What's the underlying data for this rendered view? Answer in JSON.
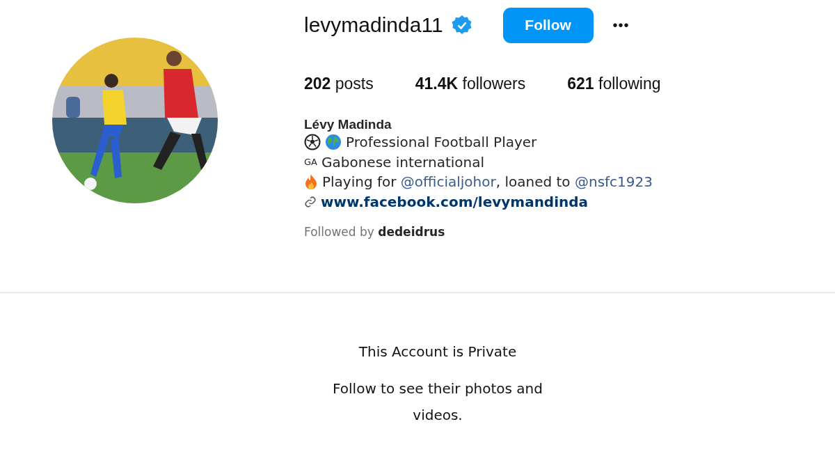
{
  "profile": {
    "username": "levymadinda11",
    "verified": true,
    "follow_button": "Follow",
    "more_button": "•••"
  },
  "stats": [
    {
      "count": "202",
      "label": "posts"
    },
    {
      "count": "41.4K",
      "label": "followers"
    },
    {
      "count": "621",
      "label": "following"
    }
  ],
  "full_name": "Lévy Madinda",
  "bio": [
    {
      "kind": "sport",
      "segments": [
        {
          "text": "Professional Football Player"
        }
      ]
    },
    {
      "kind": "country",
      "prefix": "GA",
      "segments": [
        {
          "text": "Gabonese international"
        }
      ]
    },
    {
      "kind": "club",
      "segments": [
        {
          "text": "Playing for "
        },
        {
          "text": "@officialjohor",
          "kind": "mention"
        },
        {
          "text": ", loaned to "
        },
        {
          "text": "@nsfc1923",
          "kind": "mention"
        }
      ]
    },
    {
      "kind": "link",
      "segments": [
        {
          "text": "www.facebook.com/levymandinda"
        }
      ]
    }
  ],
  "followed_by": {
    "label": "Followed by",
    "user": "dedeidrus"
  },
  "private_notice": {
    "title": "This Account is Private",
    "message": "Follow to see their photos and videos."
  }
}
